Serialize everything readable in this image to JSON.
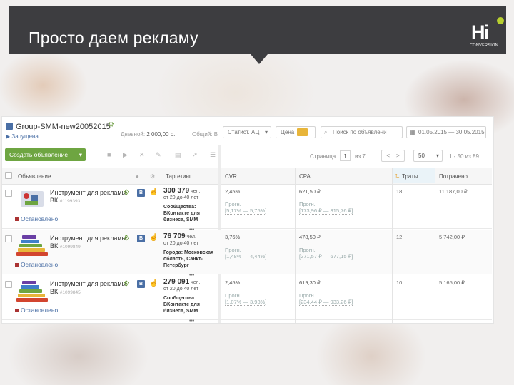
{
  "slide": {
    "title": "Просто даем рекламу",
    "logo_text": "Hi",
    "logo_subtext": "CONVERSION"
  },
  "campaign": {
    "name": "Group-SMM-new20052015",
    "status": "▶ Запущена",
    "budget_label": "Дневной:",
    "budget_value": "2 000,00 р.",
    "total_label": "Общий: В"
  },
  "filters": {
    "stats": "Статист. АЦ",
    "price_label": "Цена",
    "search_placeholder": "Поиск по объявлени",
    "date_range": "01.05.2015 — 30.05.2015"
  },
  "toolbar": {
    "create_button": "Создать объявление",
    "page_label": "Страница",
    "page_current": "1",
    "page_total": "из 7",
    "prev": "<",
    "next": ">",
    "per_page": "50",
    "range": "1 - 50 из 89"
  },
  "table": {
    "headers": {
      "ad": "Объявление",
      "reach": "Таргетинг",
      "ctr": "CVR",
      "cpa": "CPA",
      "spent": "Траты",
      "total": "Потрачено"
    },
    "rows": [
      {
        "title": "Инструмент для рекламы ВК",
        "id": "#1199393",
        "status": "Остановлено",
        "reach_value": "300 379",
        "reach_unit": "чел.",
        "reach_age": "от 20 до 40 лет",
        "audience": "Сообщества: ВКонтакте для бизнеса, SMM",
        "ctr_main": "2,45%",
        "ctr_sub": "Прогн.",
        "ctr_range": "[5,17% — 5,75%]",
        "cpa_main": "621,50 ₽",
        "cpa_sub": "Прогн.",
        "cpa_range": "[173,96 ₽ — 315,76 ₽]",
        "spent": "18",
        "total": "11 187,00 ₽"
      },
      {
        "title": "Инструмент для рекламы ВК",
        "id": "#1099849",
        "status": "Остановлено",
        "reach_value": "76 709",
        "reach_unit": "чел.",
        "reach_age": "от 20 до 40 лет",
        "audience": "Города: Московская область, Санкт-Петербург",
        "ctr_main": "3,76%",
        "ctr_sub": "Прогн.",
        "ctr_range": "[1,48% — 4,44%]",
        "cpa_main": "478,50 ₽",
        "cpa_sub": "Прогн.",
        "cpa_range": "[271,57 ₽ — 677,15 ₽]",
        "spent": "12",
        "total": "5 742,00 ₽"
      },
      {
        "title": "Инструмент для рекламы ВК",
        "id": "#1099845",
        "status": "Остановлено",
        "reach_value": "279 091",
        "reach_unit": "чел.",
        "reach_age": "от 20 до 40 лет",
        "audience": "Сообщества: ВКонтакте для бизнеса, SMM",
        "ctr_main": "2,45%",
        "ctr_sub": "Прогн.",
        "ctr_range": "[1,07% — 3,93%]",
        "cpa_main": "619,30 ₽",
        "cpa_sub": "Прогн.",
        "cpa_range": "[234,44 ₽ — 933,26 ₽]",
        "spent": "10",
        "total": "5 165,00 ₽"
      }
    ]
  },
  "colors": {
    "header_bg": "#3d3d40",
    "accent_green": "#6ea541",
    "link_blue": "#4a6fa5",
    "stop_red": "#aa3333"
  }
}
